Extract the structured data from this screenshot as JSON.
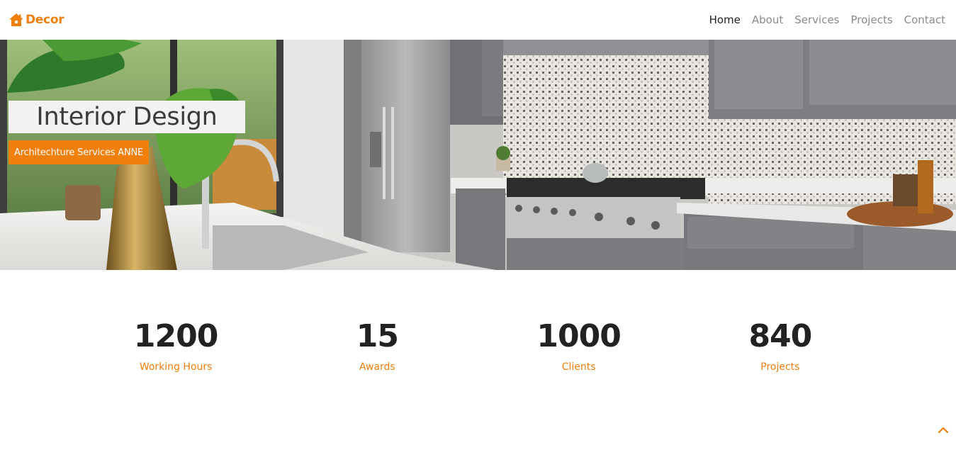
{
  "brand": {
    "name": "Decor",
    "icon": "house-icon",
    "color": "#f07f0c"
  },
  "nav": {
    "items": [
      {
        "label": "Home",
        "active": true
      },
      {
        "label": "About",
        "active": false
      },
      {
        "label": "Services",
        "active": false
      },
      {
        "label": "Projects",
        "active": false
      },
      {
        "label": "Contact",
        "active": false
      }
    ]
  },
  "hero": {
    "title": "Interior Design",
    "subtitle": "Architechture Services ANNE",
    "image": "kitchen-interior-photo"
  },
  "stats": [
    {
      "value": "1200",
      "label": "Working Hours"
    },
    {
      "value": "15",
      "label": "Awards"
    },
    {
      "value": "1000",
      "label": "Clients"
    },
    {
      "value": "840",
      "label": "Projects"
    }
  ],
  "back_to_top": {
    "icon": "chevron-up-icon"
  },
  "colors": {
    "accent": "#f07f0c",
    "text": "#222222",
    "muted": "#8a8a8a"
  }
}
